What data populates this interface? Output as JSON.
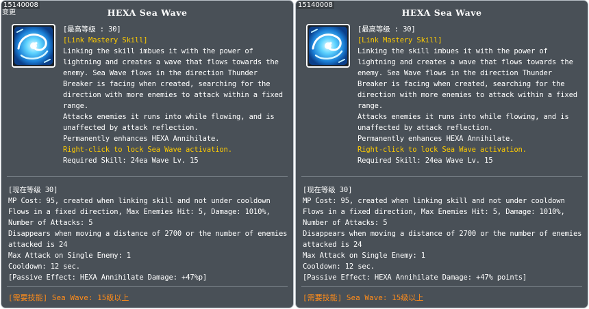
{
  "panels": [
    {
      "id_tag": "15140008",
      "badge": "变更",
      "title": "HEXA Sea Wave",
      "max_level": "[最高等级 : 30]",
      "link_tag": "[Link Mastery Skill]",
      "desc_lines": [
        "Linking the skill imbues it with the power of",
        "lightning and creates a wave that flows towards the",
        "enemy. Sea Wave flows in the direction Thunder",
        "Breaker is facing when created, searching for the",
        "direction with more enemies to attack within a fixed",
        "range.",
        "Attacks enemies it runs into while flowing, and is",
        "unaffected by attack reflection.",
        "Permanently enhances HEXA Annihilate."
      ],
      "hint": "Right-click to lock Sea Wave activation.",
      "required_skill": "Required Skill: 24ea Wave Lv. 15",
      "current_level": "[现在等级 30]",
      "current_lines": [
        "MP Cost: 95, created when linking skill and not under cooldown",
        "Flows in a fixed direction, Max Enemies Hit: 5, Damage: 1010%,",
        "Number of Attacks: 5",
        "Disappears when moving a distance of 2700 or the number of enemies",
        "attacked is 24",
        "Max Attack on Single Enemy: 1",
        "Cooldown: 12 sec.",
        "[Passive Effect: HEXA Annihilate Damage: +47%p]"
      ],
      "requirement": "[需要技能] Sea Wave: 15级以上"
    },
    {
      "id_tag": "15140008",
      "badge": "",
      "title": "HEXA Sea Wave",
      "max_level": "[最高等级 : 30]",
      "link_tag": "[Link Mastery Skill]",
      "desc_lines": [
        "Linking the skill imbues it with the power of",
        "lightning and creates a wave that flows towards the",
        "enemy. Sea Wave flows in the direction Thunder",
        "Breaker is facing when created, searching for the",
        "direction with more enemies to attack within a fixed",
        "range.",
        "Attacks enemies it runs into while flowing, and is",
        "unaffected by attack reflection.",
        "Permanently enhances HEXA Annihilate."
      ],
      "hint": "Right-click to lock Sea Wave activation.",
      "required_skill": "Required Skill: 24ea Wave Lv. 15",
      "current_level": "[现在等级 30]",
      "current_lines": [
        "MP Cost: 95, created when linking skill and not under cooldown",
        "Flows in a fixed direction, Max Enemies Hit: 5, Damage: 1010%,",
        "Number of Attacks: 5",
        "Disappears when moving a distance of 2700 or the number of enemies",
        "attacked is 24",
        "Max Attack on Single Enemy: 1",
        "Cooldown: 12 sec.",
        "[Passive Effect: HEXA Annihilate Damage: +47% points]"
      ],
      "requirement": "[需要技能] Sea Wave: 15级以上"
    }
  ],
  "colors": {
    "panel_bg": "#495057",
    "text": "#ffffff",
    "accent_gold": "#ffcc00",
    "requirement_orange": "#ff8c1a"
  },
  "icons": {
    "skill_icon": "sea-wave-skill-icon"
  }
}
